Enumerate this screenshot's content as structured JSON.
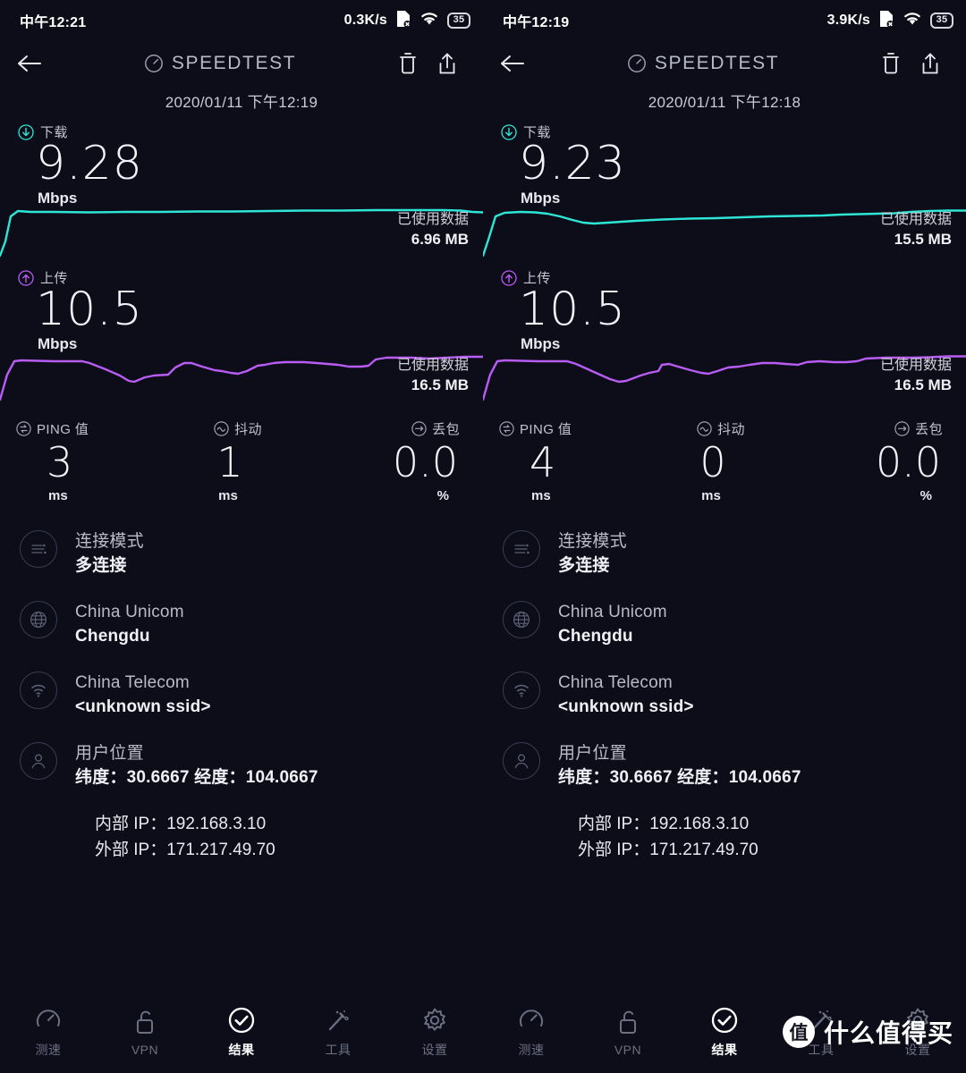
{
  "panels": [
    {
      "status": {
        "time": "中午12:21",
        "net_speed": "0.3K/s",
        "battery": "35"
      },
      "appbar": {
        "title": "SPEEDTEST",
        "back_icon": "back-arrow-icon",
        "delete_icon": "trash-icon",
        "share_icon": "share-icon",
        "gauge_icon": "speedometer-icon"
      },
      "datestamp": "2020/01/11 下午12:19",
      "download": {
        "label": "下载",
        "value": "9.28",
        "unit": "Mbps",
        "used_label": "已使用数据",
        "used_value": "6.96 MB"
      },
      "upload": {
        "label": "上传",
        "value": "10.5",
        "unit": "Mbps",
        "used_label": "已使用数据",
        "used_value": "16.5 MB"
      },
      "metrics": [
        {
          "label": "PING 值",
          "value": "3",
          "unit": "ms",
          "icon": "ping-icon"
        },
        {
          "label": "抖动",
          "value": "1",
          "unit": "ms",
          "icon": "jitter-icon"
        },
        {
          "label": "丢包",
          "value": "0.0",
          "unit": "%",
          "icon": "packet-loss-icon"
        }
      ],
      "info": {
        "conn_mode_label": "连接模式",
        "conn_mode_value": "多连接",
        "isp_name": "China Unicom",
        "isp_city": "Chengdu",
        "wifi_name": "China Telecom",
        "wifi_ssid": "<unknown ssid>",
        "location_label": "用户位置",
        "location_value": "纬度：30.6667 经度：104.0667",
        "internal_ip": "内部 IP：192.168.3.10",
        "external_ip": "外部 IP：171.217.49.70"
      }
    },
    {
      "status": {
        "time": "中午12:19",
        "net_speed": "3.9K/s",
        "battery": "35"
      },
      "appbar": {
        "title": "SPEEDTEST",
        "back_icon": "back-arrow-icon",
        "delete_icon": "trash-icon",
        "share_icon": "share-icon",
        "gauge_icon": "speedometer-icon"
      },
      "datestamp": "2020/01/11 下午12:18",
      "download": {
        "label": "下载",
        "value": "9.23",
        "unit": "Mbps",
        "used_label": "已使用数据",
        "used_value": "15.5 MB"
      },
      "upload": {
        "label": "上传",
        "value": "10.5",
        "unit": "Mbps",
        "used_label": "已使用数据",
        "used_value": "16.5 MB"
      },
      "metrics": [
        {
          "label": "PING 值",
          "value": "4",
          "unit": "ms",
          "icon": "ping-icon"
        },
        {
          "label": "抖动",
          "value": "0",
          "unit": "ms",
          "icon": "jitter-icon"
        },
        {
          "label": "丢包",
          "value": "0.0",
          "unit": "%",
          "icon": "packet-loss-icon"
        }
      ],
      "info": {
        "conn_mode_label": "连接模式",
        "conn_mode_value": "多连接",
        "isp_name": "China Unicom",
        "isp_city": "Chengdu",
        "wifi_name": "China Telecom",
        "wifi_ssid": "<unknown ssid>",
        "location_label": "用户位置",
        "location_value": "纬度：30.6667 经度：104.0667",
        "internal_ip": "内部 IP：192.168.3.10",
        "external_ip": "外部 IP：171.217.49.70"
      }
    }
  ],
  "nav": {
    "items": [
      {
        "label": "测速",
        "icon": "speedometer-icon",
        "active": false
      },
      {
        "label": "VPN",
        "icon": "unlock-icon",
        "active": false
      },
      {
        "label": "结果",
        "icon": "check-circle-icon",
        "active": true
      },
      {
        "label": "工具",
        "icon": "magic-wand-icon",
        "active": false
      },
      {
        "label": "设置",
        "icon": "gear-icon",
        "active": false
      }
    ]
  },
  "watermark": {
    "logo_char": "值",
    "text": "什么值得买"
  },
  "colors": {
    "background": "#0c0d18",
    "download_line": "#2ee6d6",
    "upload_line": "#b95cf4",
    "accent_text": "#f2f3f8",
    "muted_text": "#b9bac7",
    "nav_inactive": "#6d6f83"
  },
  "chart_data": [
    {
      "type": "line",
      "title": "下载 9.28 Mbps",
      "panel": "left",
      "series_name": "download",
      "color": "#2ee6d6",
      "ylabel": "Mbps",
      "ylim": [
        0,
        11
      ],
      "x": [
        0,
        2,
        4,
        7,
        10,
        15,
        20,
        25,
        30,
        35,
        40,
        45,
        50,
        55,
        60,
        65,
        70,
        75,
        80,
        85,
        90,
        93,
        96,
        100
      ],
      "values": [
        0.3,
        5.4,
        9.1,
        9.25,
        9.2,
        9.28,
        9.25,
        9.27,
        9.3,
        9.28,
        9.3,
        9.34,
        9.32,
        9.34,
        9.36,
        9.34,
        9.36,
        9.38,
        9.38,
        9.4,
        9.4,
        9.4,
        9.3,
        9.2
      ]
    },
    {
      "type": "line",
      "title": "上传 10.5 Mbps",
      "panel": "left",
      "series_name": "upload",
      "color": "#b95cf4",
      "ylabel": "Mbps",
      "ylim": [
        0,
        12
      ],
      "x": [
        0,
        2,
        5,
        10,
        16,
        18,
        22,
        26,
        30,
        34,
        38,
        42,
        46,
        50,
        54,
        58,
        62,
        66,
        70,
        74,
        78,
        82,
        86,
        90,
        94,
        100
      ],
      "values": [
        0.5,
        9.9,
        9.6,
        9.6,
        9.6,
        9.3,
        8.9,
        8.4,
        8.8,
        9.0,
        9.6,
        9.8,
        9.4,
        9.0,
        9.0,
        9.4,
        9.9,
        10.0,
        10.1,
        10.1,
        9.9,
        9.8,
        10.5,
        10.6,
        10.5,
        10.6
      ]
    },
    {
      "type": "line",
      "title": "下载 9.23 Mbps",
      "panel": "right",
      "series_name": "download",
      "color": "#2ee6d6",
      "ylabel": "Mbps",
      "ylim": [
        0,
        11
      ],
      "x": [
        0,
        2,
        5,
        9,
        13,
        17,
        21,
        25,
        30,
        36,
        42,
        48,
        54,
        60,
        66,
        72,
        78,
        84,
        90,
        95,
        100
      ],
      "values": [
        0.3,
        8.8,
        9.3,
        9.4,
        9.3,
        8.9,
        8.5,
        8.4,
        8.7,
        8.9,
        9.0,
        9.1,
        9.2,
        9.25,
        9.3,
        9.4,
        9.4,
        9.45,
        9.55,
        9.7,
        9.7
      ]
    },
    {
      "type": "line",
      "title": "上传 10.5 Mbps",
      "panel": "right",
      "series_name": "upload",
      "color": "#b95cf4",
      "ylabel": "Mbps",
      "ylim": [
        0,
        12
      ],
      "x": [
        0,
        2,
        5,
        10,
        16,
        18,
        22,
        26,
        30,
        34,
        37,
        40,
        44,
        48,
        52,
        56,
        60,
        66,
        70,
        74,
        78,
        84,
        90,
        95,
        100
      ],
      "values": [
        0.5,
        9.9,
        9.6,
        9.6,
        9.6,
        9.3,
        8.8,
        8.3,
        8.4,
        8.9,
        9.6,
        9.3,
        9.1,
        8.9,
        9.2,
        9.7,
        9.9,
        9.8,
        10.0,
        10.2,
        10.1,
        10.1,
        10.5,
        10.5,
        10.6
      ]
    }
  ]
}
